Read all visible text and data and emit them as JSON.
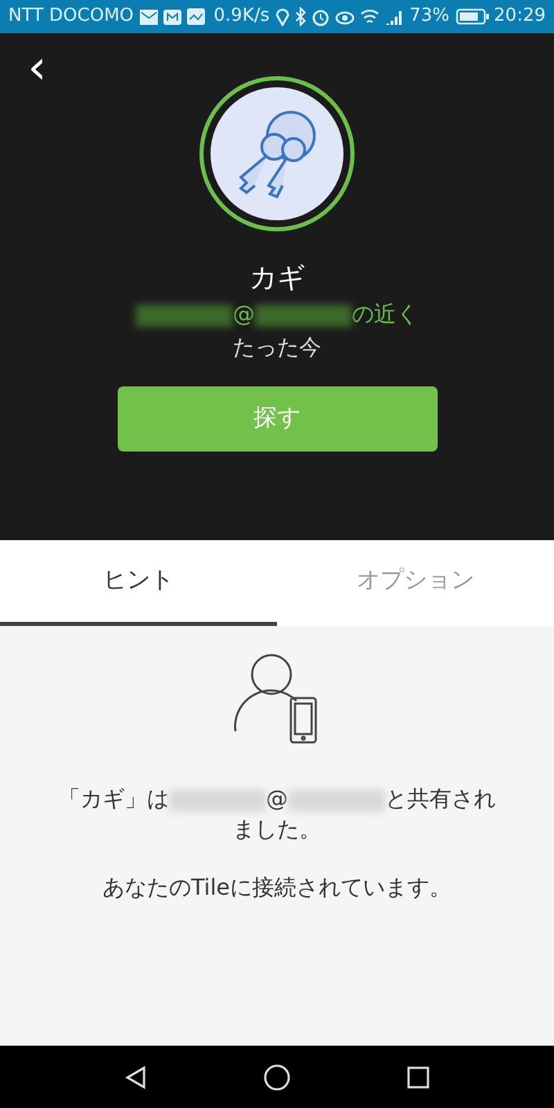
{
  "status_bar": {
    "carrier": "NTT DOCOMO",
    "speed": "0.9K/s",
    "battery": "73%",
    "time": "20:29"
  },
  "header": {
    "back": "‹",
    "title": "カギ",
    "location_parts": [
      {
        "kind": "redacted"
      },
      {
        "kind": "text",
        "text": "@"
      },
      {
        "kind": "redacted"
      },
      {
        "kind": "text",
        "text": "の近く"
      }
    ],
    "last_seen": "たった今",
    "find_button": "探す"
  },
  "tabs": [
    {
      "label": "ヒント",
      "selected": true
    },
    {
      "label": "オプション",
      "selected": false
    }
  ],
  "hint": {
    "share_parts": [
      {
        "kind": "text",
        "text": "「カギ」は"
      },
      {
        "kind": "redacted"
      },
      {
        "kind": "text",
        "text": "@"
      },
      {
        "kind": "redacted"
      },
      {
        "kind": "text",
        "text": "と共有されました。"
      }
    ],
    "connected": "あなたのTileに接続されています。"
  }
}
